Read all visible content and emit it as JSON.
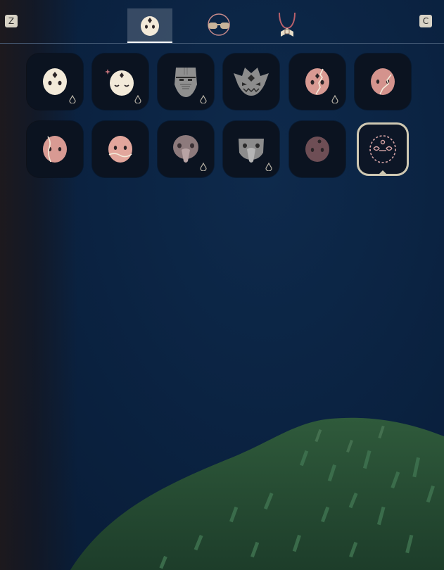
{
  "key_hints": {
    "left": "Z",
    "right": "C"
  },
  "tabs": [
    {
      "icon": "mask-tab-icon",
      "active": true
    },
    {
      "icon": "glasses-tab-icon",
      "active": false
    },
    {
      "icon": "necklace-tab-icon",
      "active": false
    }
  ],
  "masks": [
    {
      "icon": "white-face-mask-icon",
      "has_drop": true
    },
    {
      "icon": "sleeping-face-mask-icon",
      "has_drop": true
    },
    {
      "icon": "stitched-gray-mask-icon",
      "has_drop": true
    },
    {
      "icon": "horned-gray-mask-icon",
      "has_drop": false
    },
    {
      "icon": "cracked-pink-mask-icon",
      "has_drop": true
    },
    {
      "icon": "cracked-salmon-mask-icon",
      "has_drop": false
    },
    {
      "icon": "vein-pink-mask-icon",
      "has_drop": false
    },
    {
      "icon": "smile-line-pink-mask-icon",
      "has_drop": false
    },
    {
      "icon": "beak-mauve-mask-icon",
      "has_drop": true
    },
    {
      "icon": "beak-gray-mask-icon",
      "has_drop": true
    },
    {
      "icon": "dark-round-mask-icon",
      "has_drop": false
    },
    {
      "icon": "dashed-outline-mask-icon",
      "has_drop": false,
      "selected": true
    }
  ],
  "colors": {
    "background": "#0b2342",
    "slot": "#0b1320",
    "mask_white": "#f3ead9",
    "mask_pink": "#d89a93",
    "mask_gray": "#8f8f8f",
    "selection_border": "#cfc8b2",
    "grass": "#2f5a3b"
  }
}
